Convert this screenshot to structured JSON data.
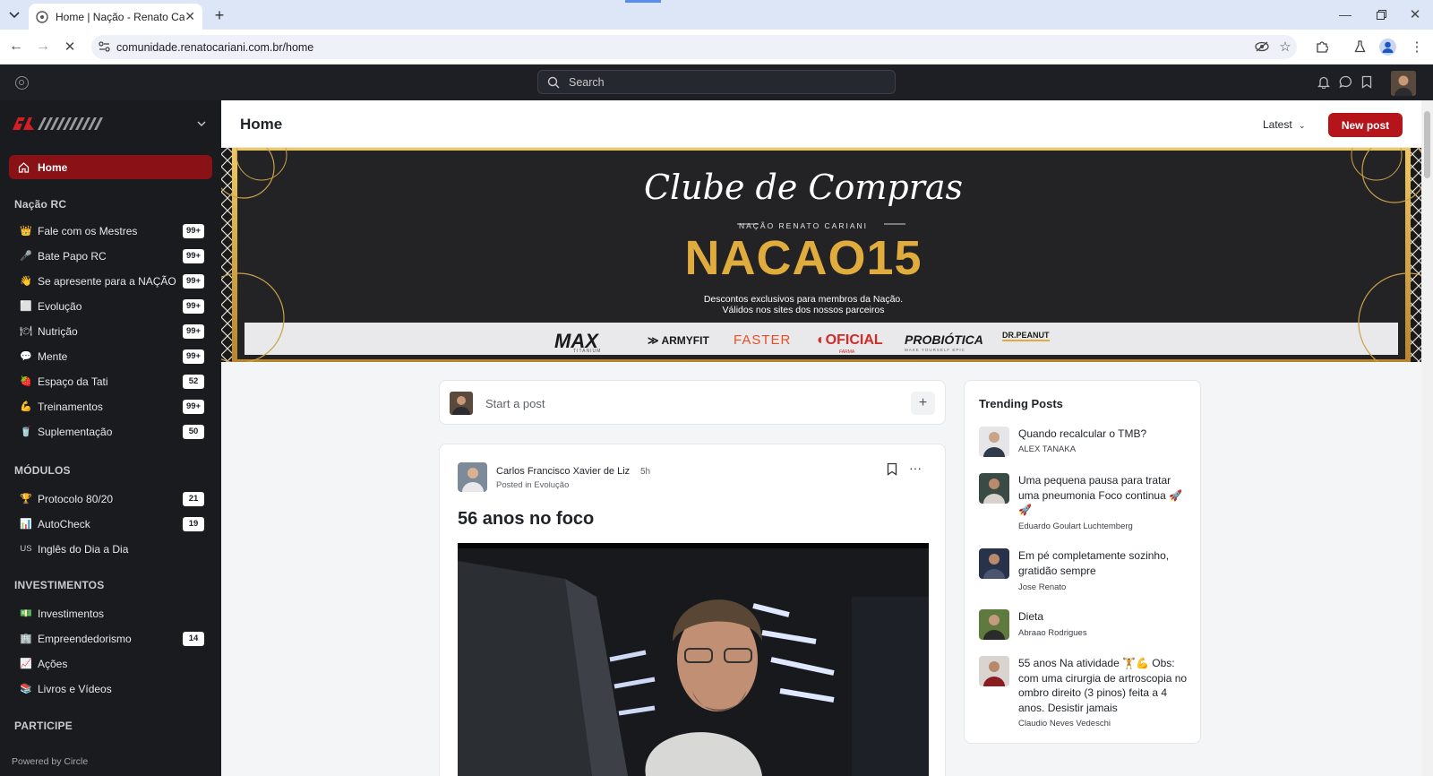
{
  "browser": {
    "tab_title": "Home | Nação - Renato Cariani",
    "url": "comunidade.renatocariani.com.br/home"
  },
  "app": {
    "search_placeholder": "Search"
  },
  "sidebar": {
    "home": "Home",
    "section_nacao": "Nação RC",
    "nacao_items": [
      {
        "icon": "crown-icon",
        "label": "Fale com os Mestres",
        "badge": "99+"
      },
      {
        "icon": "microphone-icon",
        "label": "Bate Papo RC",
        "badge": "99+"
      },
      {
        "icon": "waving-hand-icon",
        "label": "Se apresente para a NAÇÃO",
        "badge": "99+"
      },
      {
        "icon": "chart-icon",
        "label": "Evolução",
        "badge": "99+"
      },
      {
        "icon": "plate-icon",
        "label": "Nutrição",
        "badge": "99+"
      },
      {
        "icon": "speech-icon",
        "label": "Mente",
        "badge": "99+"
      },
      {
        "icon": "strawberry-icon",
        "label": "Espaço da Tati",
        "badge": "52"
      },
      {
        "icon": "flexed-biceps-icon",
        "label": "Treinamentos",
        "badge": "99+"
      },
      {
        "icon": "cup-icon",
        "label": "Suplementação",
        "badge": "50"
      }
    ],
    "section_modulos": "MÓDULOS",
    "modulos_items": [
      {
        "icon": "trophy-icon",
        "label": "Protocolo 80/20",
        "badge": "21"
      },
      {
        "icon": "bar-chart-icon",
        "label": "AutoCheck",
        "badge": "19"
      },
      {
        "icon": "us-flag-icon",
        "icon_text": "US",
        "label": "Inglês do Dia a Dia",
        "badge": ""
      }
    ],
    "section_investimentos": "INVESTIMENTOS",
    "investimentos_items": [
      {
        "icon": "money-icon",
        "label": "Investimentos",
        "badge": ""
      },
      {
        "icon": "building-icon",
        "label": "Empreendedorismo",
        "badge": "14"
      },
      {
        "icon": "trend-up-icon",
        "label": "Ações",
        "badge": ""
      },
      {
        "icon": "books-icon",
        "label": "Livros e Vídeos",
        "badge": ""
      }
    ],
    "section_participe": "PARTICIPE",
    "powered_by": "Powered by Circle"
  },
  "main": {
    "title": "Home",
    "sort": "Latest",
    "new_post": "New post"
  },
  "banner": {
    "script_title": "Clube de Compras",
    "subtitle": "NAÇÃO RENATO CARIANI",
    "code": "NACAO15",
    "desc_line1": "Descontos exclusivos para membros da Nação.",
    "desc_line2": "Válidos nos sites dos nossos parceiros",
    "brands": [
      "MAX",
      "ARMYFIT",
      "FASTER",
      "OFICIAL",
      "PROBIÓTICA",
      "DR.PEANUT"
    ],
    "brand_small": [
      "TITANIUM",
      "",
      "",
      "FARMA",
      "MAKE YOURSELF EPIC",
      ""
    ]
  },
  "composer": {
    "placeholder": "Start a post"
  },
  "post": {
    "author": "Carlos Francisco Xavier de Liz",
    "time": "5h",
    "posted_in_prefix": "Posted in",
    "space": "Evolução",
    "title": "56 anos no foco"
  },
  "trending": {
    "heading": "Trending Posts",
    "items": [
      {
        "title": "Quando recalcular o TMB?",
        "author": "ALEX TANAKA"
      },
      {
        "title": "Uma pequena pausa para tratar uma pneumonia Foco continua 🚀🚀",
        "author": "Eduardo Goulart Luchtemberg"
      },
      {
        "title": "Em pé completamente sozinho, gratidão sempre",
        "author": "Jose Renato"
      },
      {
        "title": "Dieta",
        "author": "Abraao Rodrigues"
      },
      {
        "title": "55 anos Na atividade 🏋💪 Obs: com uma cirurgia de artroscopia no ombro direito (3 pinos) feita a 4 anos. Desistir jamais",
        "author": "Claudio Neves Vedeschi"
      }
    ]
  },
  "colors": {
    "accent": "#b5151a",
    "sidebar_bg": "#191b1f",
    "active_bg": "#8a1216",
    "gold": "#d9a93a"
  }
}
